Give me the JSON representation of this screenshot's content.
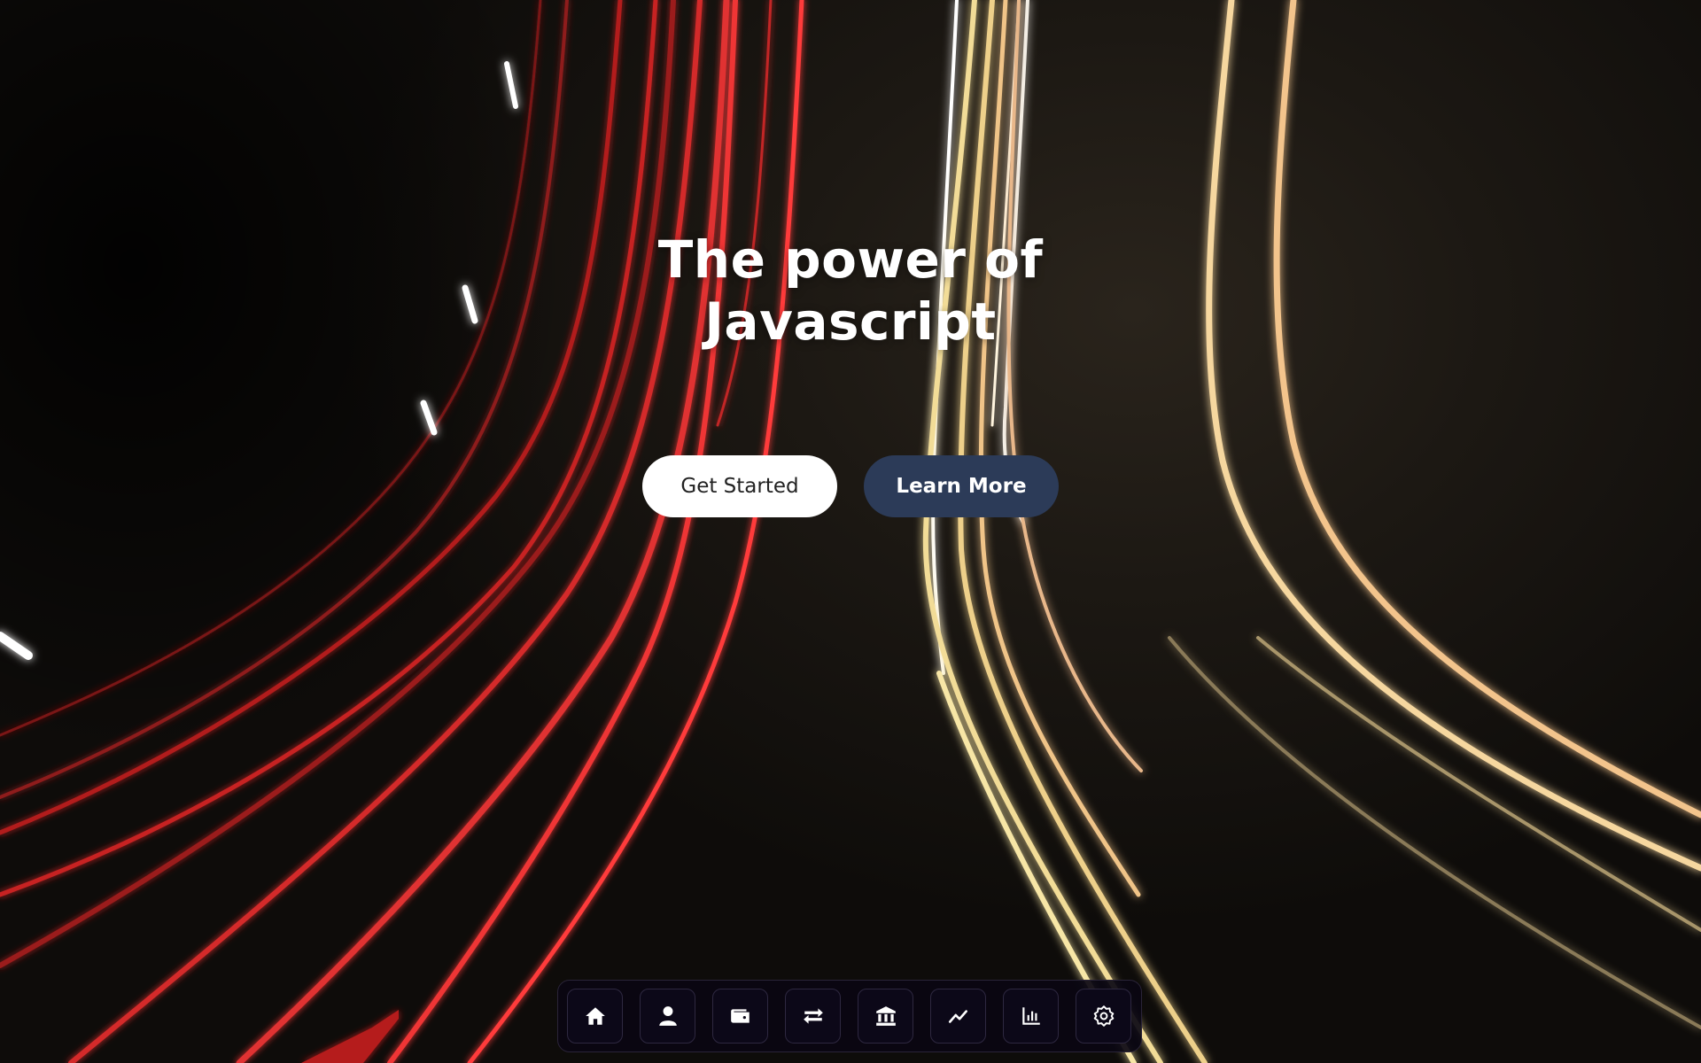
{
  "hero": {
    "title_line1": "The power of",
    "title_line2": "Javascript",
    "primary_button": "Get Started",
    "secondary_button": "Learn More"
  },
  "dock": {
    "items": [
      {
        "id": "home",
        "icon": "home-icon"
      },
      {
        "id": "profile",
        "icon": "user-icon"
      },
      {
        "id": "wallet",
        "icon": "wallet-icon"
      },
      {
        "id": "transfer",
        "icon": "arrows-exchange-icon"
      },
      {
        "id": "bank",
        "icon": "bank-icon"
      },
      {
        "id": "trend",
        "icon": "trend-line-icon"
      },
      {
        "id": "analytics",
        "icon": "bar-chart-icon"
      },
      {
        "id": "settings",
        "icon": "gear-icon"
      }
    ]
  },
  "colors": {
    "red_streak": "#ff3b3b",
    "gold_streak": "#f5dfa0",
    "white_streak": "#ffffff",
    "secondary_button_bg": "#2c3b58",
    "dock_bg": "#0a0612"
  }
}
